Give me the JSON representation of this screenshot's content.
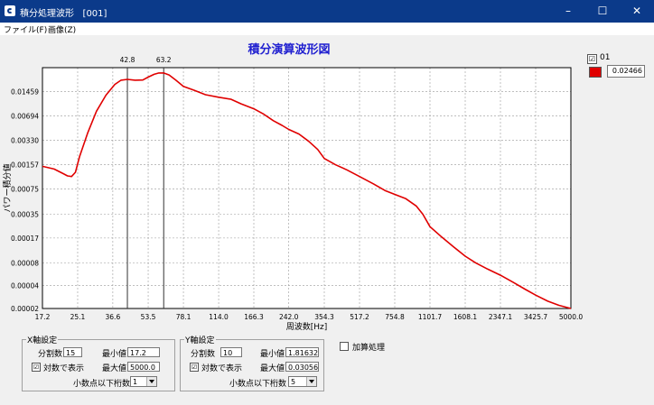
{
  "window": {
    "title": "積分処理波形",
    "id": "[001]",
    "minimize": "–",
    "maximize": "☐",
    "close": "✕"
  },
  "menu": [
    "ファイル(F)",
    "画像(Z)"
  ],
  "chart_data": {
    "type": "line",
    "title": "積分演算波形図",
    "xlabel": "周波数[Hz]",
    "ylabel": "パワー積分値",
    "x_scale": "log",
    "y_scale": "log",
    "xlim": [
      17.2,
      5000.0
    ],
    "ylim": [
      2e-05,
      0.03
    ],
    "x_ticks": [
      "17.2",
      "25.1",
      "36.6",
      "53.5",
      "78.1",
      "114.0",
      "166.3",
      "242.0",
      "354.3",
      "517.2",
      "754.8",
      "1101.7",
      "1608.1",
      "2347.1",
      "3425.7",
      "5000.0"
    ],
    "y_ticks": [
      "0.00002",
      "0.00004",
      "0.00008",
      "0.00017",
      "0.00035",
      "0.00075",
      "0.00157",
      "0.00330",
      "0.00694",
      "0.01459"
    ],
    "grid": true,
    "markers": [
      {
        "x": 42.8,
        "label": "42.8"
      },
      {
        "x": 63.2,
        "label": "63.2"
      }
    ],
    "series": [
      {
        "name": "01",
        "color": "#e00000",
        "x": [
          17.2,
          19.5,
          21.5,
          22.5,
          23.5,
          24.5,
          25.6,
          28.0,
          30.7,
          34.0,
          37.4,
          40.0,
          42.8,
          46.5,
          50.5,
          53.5,
          57.0,
          60.0,
          63.2,
          67.0,
          72.0,
          78.1,
          88.0,
          99.0,
          114.0,
          130.0,
          145.0,
          166.3,
          185.0,
          205.0,
          225.0,
          242.0,
          270.0,
          300.0,
          330.0,
          354.3,
          400.0,
          450.0,
          517.2,
          600.0,
          680.0,
          754.8,
          850.0,
          950.0,
          1020.0,
          1101.7,
          1250.0,
          1420.0,
          1608.1,
          1800.0,
          2050.0,
          2347.1,
          2700.0,
          3050.0,
          3425.7,
          3900.0,
          4400.0,
          5000.0
        ],
        "y": [
          0.0015,
          0.00138,
          0.0012,
          0.00112,
          0.0011,
          0.00125,
          0.002,
          0.0042,
          0.008,
          0.013,
          0.018,
          0.0205,
          0.021,
          0.0205,
          0.0206,
          0.0225,
          0.0245,
          0.0255,
          0.0255,
          0.024,
          0.0205,
          0.017,
          0.015,
          0.0132,
          0.0122,
          0.0115,
          0.01,
          0.0086,
          0.0073,
          0.006,
          0.0052,
          0.0046,
          0.004,
          0.0032,
          0.0025,
          0.0019,
          0.00157,
          0.00135,
          0.0011,
          0.00088,
          0.00072,
          0.00064,
          0.00056,
          0.00045,
          0.00035,
          0.00024,
          0.000175,
          0.00013,
          9.8e-05,
          8e-05,
          6.6e-05,
          5.5e-05,
          4.4e-05,
          3.6e-05,
          3e-05,
          2.5e-05,
          2.2e-05,
          2e-05
        ]
      }
    ]
  },
  "legend": {
    "checked": "☑",
    "series_name": "01",
    "value": "0.02466"
  },
  "x_settings": {
    "title": "X軸設定",
    "divisions_label": "分割数",
    "divisions": "15",
    "min_label": "最小値",
    "min": "17.2",
    "log_label": "対数で表示",
    "log_check": "☑",
    "max_label": "最大値",
    "max": "5000.0",
    "decimals_label": "小数点以下桁数",
    "decimals": "1"
  },
  "y_settings": {
    "title": "Y軸設定",
    "divisions_label": "分割数",
    "divisions": "10",
    "min_label": "最小値",
    "min": "1.816324",
    "log_label": "対数で表示",
    "log_check": "☑",
    "max_label": "最大値",
    "max": "0.030568",
    "decimals_label": "小数点以下桁数",
    "decimals": "5"
  },
  "accumulate": {
    "label": "加算処理"
  }
}
